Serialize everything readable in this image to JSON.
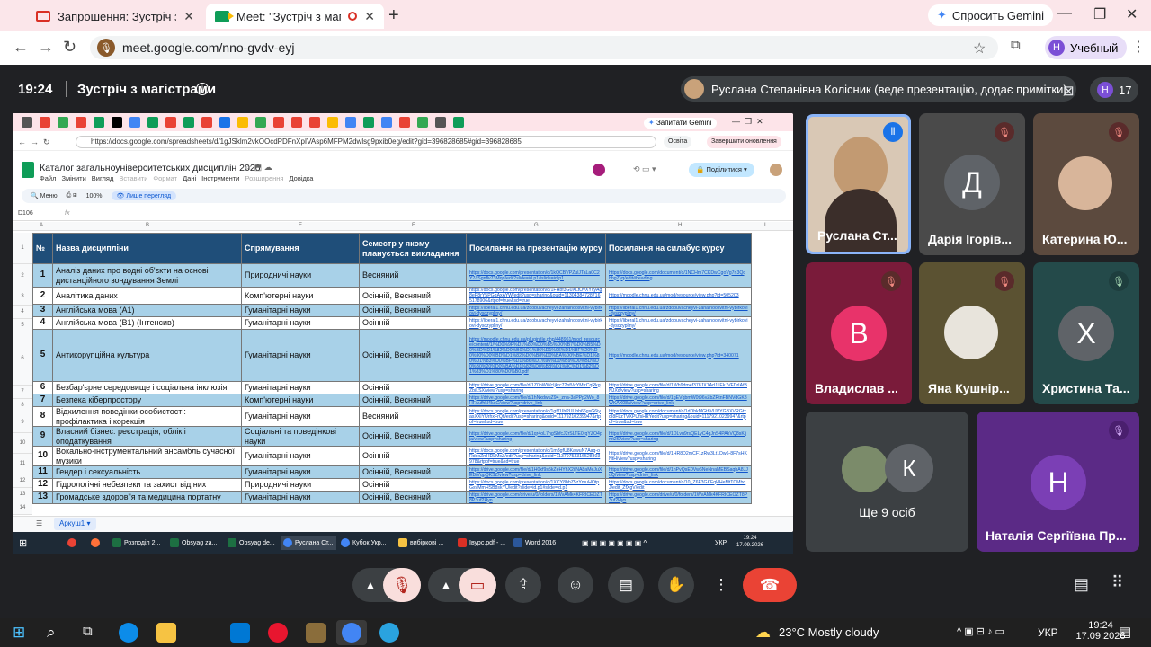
{
  "browser": {
    "tabs": [
      {
        "title": "Запрошення: Зустріч з магістр"
      },
      {
        "title": "Meet: \"Зустріч з магістрами\""
      }
    ],
    "gemini_button": "Спросить Gemini",
    "url": "meet.google.com/nno-gvdv-eyj",
    "profile_label": "Учебный",
    "profile_initial": "Н"
  },
  "meet": {
    "time": "19:24",
    "title": "Зустріч з магістрами",
    "presenter_text": "Руслана Степанівна Колісник (веде презентацію, додає примітки)",
    "participant_count": "17",
    "participant_initial": "Н",
    "more_people": "Ще 9 осіб",
    "tiles": [
      {
        "name": "Руслана Ст..."
      },
      {
        "name": "Дарія Ігорів...",
        "initial": "Д"
      },
      {
        "name": "Катерина Ю..."
      },
      {
        "name": "Владислав ...",
        "initial": "В"
      },
      {
        "name": "Яна Кушнір..."
      },
      {
        "name": "Христина Та...",
        "initial": "Х"
      },
      {
        "name": "Наталія Сергіївна Пр...",
        "initial": "Н"
      }
    ],
    "group_initial": "К"
  },
  "shared": {
    "gemini_btn": "Запитати Gemini",
    "url": "https://docs.google.com/spreadsheets/d/1gJSklm2vkOOcdPDFnXpIVAsp6MFPM2dwlsg9pxib0eg/edit?gid=396828685#gid=396828685",
    "profile_btn": "Освіта",
    "update_btn": "Завершити оновлення",
    "doc_title": "Каталог загальноуніверситетських дисциплін 2026",
    "menu": [
      "Файл",
      "Змінити",
      "Вигляд",
      "Вставити",
      "Формат",
      "Дані",
      "Інструменти",
      "Розширення",
      "Довідка"
    ],
    "share_btn": "Поділитися",
    "toolbar_menu": "Меню",
    "zoom": "100%",
    "preview_mode": "Лише перегляд",
    "cell_ref": "D106",
    "fx": "fx",
    "col_letters": [
      "A",
      "B",
      "E",
      "F",
      "G",
      "H",
      "I"
    ],
    "sheet_tab": "Аркуш1",
    "headers": [
      "№",
      "Назва дисципліни",
      "Спрямування",
      "Семестр у якому планується викладання",
      "Посилання на презентацію курсу",
      "Посилання на силабус курсу"
    ],
    "rows": [
      {
        "rn": "2",
        "n": "1",
        "name": "Аналіз даних про водні об'єкти на основі дистанційного зондування Землі",
        "dir": "Природничі науки",
        "sem": "Весняний",
        "pres": "https://docs.google.com/presentation/d/1kQCBVPZulJTaLa0C2Y7/ISgnflv73Mqd/edit?slide=id.p1#slide=id.p1",
        "syl": "https://docs.google.com/document/d/1NCHm7CKDwCgoVg7n3QqhhgZyq/edit#heading",
        "style": "blue"
      },
      {
        "rn": "3",
        "n": "2",
        "name": "Аналітика даних",
        "dir": "Комп'ютерні науки",
        "sem": "Осінній, Весняний",
        "pres": "https://docs.google.com/presentation/d/1FHbf3G0XLtOvXYcyAg8eP8rY5PGqAxAYW/edit?usp=sharing&ouid=113043847287165178906&rtpof=true&sd=true",
        "syl": "https://moodle.chnu.edu.ua/mod/resource/view.php?id=505203",
        "style": "white"
      },
      {
        "rn": "4",
        "n": "3",
        "name": "Англійська мова (А1)",
        "dir": "Гуманітарні науки",
        "sem": "Осінній, Весняний",
        "pres": "https://liberal1.chnu.edu.ua/zdobuvacheyvi-zahalnoosvitni-vybirkovi-dysczypliny/",
        "syl": "https://liberal1.chnu.edu.ua/zdobuvacheyvi-zahalnoosvitni-vybirkovi-dysczypliny/",
        "style": "blue"
      },
      {
        "rn": "5",
        "n": "4",
        "name": "Англійська мова (В1) (Інтенсив)",
        "dir": "Гуманітарні науки",
        "sem": "Осінній",
        "pres": "https://liberal1.chnu.edu.ua/zdobuvacheyvi-zahalnoosvitni-vybirkovi-dysczypliny/",
        "syl": "https://liberal1.chnu.edu.ua/zdobuvacheyvi-zahalnoosvitni-vybirkovi-dysczypliny/",
        "style": "white"
      },
      {
        "rn": "6",
        "n": "5",
        "name": "Антикорупційна культура",
        "dir": "Гуманітарні науки",
        "sem": "Осінній, Весняний",
        "pres": "https://moodle.chnu.edu.ua/pluginfile.php/448961/mod_resource/content/1/%D0%9F%D1%80%D0%B5%D0%B7%D0%B5%D0%BD%D1%82%D0%B0%D1%86%D1%96%D1%8F%20%D0%90%D0%BD%D1%82%D0%B8%D0%BA%D0%BE%D1%80%D1%83%D0%BF%D1%86%D1%96%D0%B9%D0%BD%D0%B0%20%D0%BA%D1%83%D0%BB%D1%8C%D1%82%D1%83%D1%80%D0%B0.pdf",
        "syl": "https://moodle.chnu.edu.ua/mod/resource/view.php?id=340071",
        "style": "blue"
      },
      {
        "rn": "7",
        "n": "6",
        "name": "Безбар'єрне середовище і соціальна інклюзія",
        "dir": "Гуманітарні науки",
        "sem": "Осінній",
        "pres": "https://drive.google.com/file/d/1Z0hWWcIjkrc72nfVcYMfrCqRkgZbiLSX/view?usp=sharing",
        "syl": "https://drive.google.com/file/d/1Wh9dm4f378JX1AdJ1EkJVFDrIAfBNJXd/view?usp=sharing",
        "style": "white"
      },
      {
        "rn": "8",
        "n": "7",
        "name": "Безпека кіберпростору",
        "dir": "Комп'ютерні науки",
        "sem": "Осінній, Весняний",
        "pres": "https://drive.google.com/file/d/1hNxdwuZ94_zna-3aPPp2Wo_8HFAufhN4kaC/view?usp=drive_link",
        "syl": "https://drive.google.com/file/d/1gEVqbmW0t96vZbZRtnFBNVdGK8WKAX08a/view?usp=drive_link",
        "style": "blue"
      },
      {
        "rn": "9",
        "n": "8",
        "name": "Відхилення поведінки особистості: профілактика і корекція",
        "dir": "Гуманітарні науки",
        "sem": "Весняний",
        "pres": "https://docs.google.com/presentation/d/1gf7UhPUUbh66gsG6iyasXXiYUrhxFrQfi/edit?usp=sharing&ouid=11179210239947&rtpof=true&sd=true",
        "syl": "https://docs.google.com/document/d/1dDhkMGtbVUVYGBXVRGtxdI8FLzTVXPUfsHRYedit?usp=sharing&ouid=11179210239947&rtpof=true&sd=true",
        "style": "white"
      },
      {
        "rn": "10",
        "n": "9",
        "name": "Власний бізнес: реєстрація, облік і оподаткування",
        "dir": "Соціальні та поведінкові науки",
        "sem": "Осінній, Весняний",
        "pres": "https://drive.google.com/file/d/1qr4oL7hgSbfcJ2rSLTE0rqYZO4pja/view?usp=sharing",
        "syl": "https://drive.google.com/file/d/1DLvu9rsQELyC4qJnS4PAkVQ8sKljmt2S/view?usp=sharing",
        "style": "blue"
      },
      {
        "rn": "11",
        "n": "10",
        "name": "Вокально-інструментальний ансамбль сучасної музики",
        "dir": "Гуманітарні науки",
        "sem": "Осінній",
        "pres": "https://docs.google.com/presentation/d/1m3gfU8KawuN7Aaq-oRdoxZrrHDLMcZ/edit?usp=sharing&ouid=11379753316528803978&rtpof=true&sd=true",
        "syl": "https://drive.google.com/file/d/1HR8D2mCF1zRw3Lt1Dw6-8F7sHKNtH/view?usp=sharing",
        "style": "white"
      },
      {
        "rn": "12",
        "n": "11",
        "name": "Гендер і сексуальність",
        "dir": "Гуманітарні науки",
        "sem": "Осінній, Весняний",
        "pres": "https://drive.google.com/file/d/1H0xf9s5kZeHYhX2ijNA8aMeJuXEDiVqpQKSZ/view?usp=drive_link",
        "syl": "https://drive.google.com/file/d/1hPvQsE0Vw6NeNnaMEBSaqbA8JJoQ/view?usp=drive_link",
        "style": "blue"
      },
      {
        "rn": "13",
        "n": "12",
        "name": "Гідрологічні небезпеки та захист від них",
        "dir": "Природничі науки",
        "sem": "Осінній",
        "pres": "https://docs.google.com/presentation/d/1XCY8bhZ5zYmuHOtpGsvMmHSB8skYU/edit?slide=id.p1#slide=id.p1",
        "syl": "https://docs.google.com/document/d/10_Z6F3GKFqHHeMtTCMbdJ/edit_ZfXgV/edit",
        "style": "white"
      },
      {
        "rn": "14",
        "n": "13",
        "name": "Громадське здоров\"я та медицина портатну",
        "dir": "Гуманітарні науки",
        "sem": "Осінній, Весняний",
        "pres": "https://drive.google.com/drive/u/0/folders/1WvAMk4KFRICEOZT8P3uf2Hyn",
        "syl": "https://drive.google.com/drive/u/0/folders/1WvAMk4KFRICEOZT8P3uf2Hyn",
        "style": "blue"
      }
    ],
    "taskbar_items": [
      "Розподіл 2...",
      "Obsyag za...",
      "Obsyag de...",
      "Руслана Ст...",
      "Кубок Укр...",
      "вибіркові ...",
      "Івурс.pdf - ...",
      "Word 2016"
    ],
    "taskbar_lang": "УКР",
    "taskbar_time": "19:24",
    "taskbar_date": "17.09.2026"
  },
  "windows": {
    "weather": "23°C  Mostly cloudy",
    "lang": "УКР",
    "time": "19:24",
    "date": "17.09.2026"
  },
  "colors": {
    "meet_bg": "#202124",
    "end_call": "#ea4335",
    "header_blue": "#1f4e79",
    "row_blue": "#a8d1e8",
    "mute_bg": "#f9dedc"
  }
}
